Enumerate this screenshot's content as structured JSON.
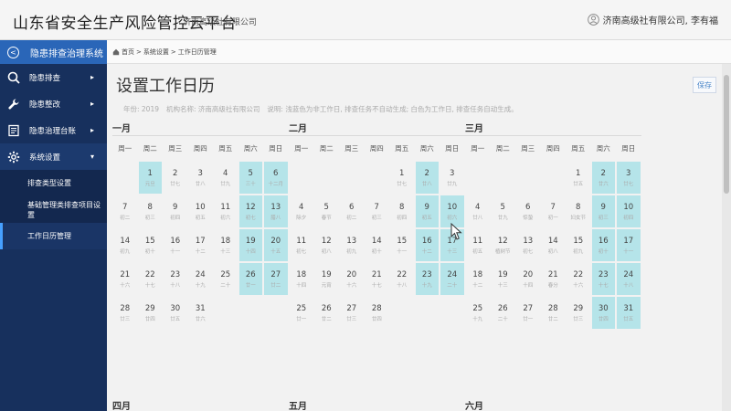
{
  "header": {
    "title": "山东省安全生产风险管控云平台",
    "org": "济南高级社有限公司",
    "user": "济南高级社有限公司, 李有福"
  },
  "sidebar": {
    "system_title": "隐患排查治理系统",
    "items": [
      {
        "label": "隐患排查",
        "icon": "search-icon",
        "arrow": "▸"
      },
      {
        "label": "隐患整改",
        "icon": "wrench-icon",
        "arrow": "▸"
      },
      {
        "label": "隐患治理台账",
        "icon": "ledger-icon",
        "arrow": "▸"
      },
      {
        "label": "系统设置",
        "icon": "gear-icon",
        "arrow": "▾"
      }
    ],
    "sub_items": [
      {
        "label": "排查类型设置"
      },
      {
        "label": "基础管理类排查项目设置"
      },
      {
        "label": "工作日历管理"
      }
    ]
  },
  "breadcrumb": {
    "home": "首页",
    "sep": ">",
    "level1": "系统设置",
    "level2": "工作日历管理"
  },
  "page": {
    "title": "设置工作日历",
    "save": "保存",
    "year": "年份: 2019",
    "org": "机构名称: 济南高级社有限公司",
    "note": "说明: 浅蓝色为非工作日, 排查任务不自动生成; 白色为工作日, 排查任务自动生成。"
  },
  "weekdays": [
    "周一",
    "周二",
    "周三",
    "周四",
    "周五",
    "周六",
    "周日"
  ],
  "months": [
    {
      "name": "一月",
      "offset": 1,
      "days": 31,
      "rest": [
        1,
        5,
        6,
        12,
        13,
        19,
        20,
        26,
        27
      ],
      "subs": {
        "1": "元旦",
        "2": "廿七",
        "3": "廿八",
        "4": "廿九",
        "5": "三十",
        "6": "十二月",
        "7": "初二",
        "8": "初三",
        "9": "初四",
        "10": "初五",
        "11": "初六",
        "12": "初七",
        "13": "腊八",
        "14": "初九",
        "15": "初十",
        "16": "十一",
        "17": "十二",
        "18": "十三",
        "19": "十四",
        "20": "十五",
        "21": "十六",
        "22": "十七",
        "23": "十八",
        "24": "十九",
        "25": "二十",
        "26": "廿一",
        "27": "廿二",
        "28": "廿三",
        "29": "廿四",
        "30": "廿五",
        "31": "廿六"
      }
    },
    {
      "name": "二月",
      "offset": 4,
      "days": 28,
      "rest": [
        2,
        9,
        10,
        16,
        17,
        23,
        24
      ],
      "subs": {
        "1": "廿七",
        "2": "廿八",
        "3": "廿九",
        "4": "除夕",
        "5": "春节",
        "6": "初二",
        "7": "初三",
        "8": "初四",
        "9": "初五",
        "10": "初六",
        "11": "初七",
        "12": "初八",
        "13": "初九",
        "14": "初十",
        "15": "十一",
        "16": "十二",
        "17": "十三",
        "18": "十四",
        "19": "元宵",
        "20": "十六",
        "21": "十七",
        "22": "十八",
        "23": "十九",
        "24": "二十",
        "25": "廿一",
        "26": "廿二",
        "27": "廿三",
        "28": "廿四"
      }
    },
    {
      "name": "三月",
      "offset": 4,
      "days": 31,
      "rest": [
        2,
        3,
        9,
        10,
        16,
        17,
        23,
        24,
        30,
        31
      ],
      "subs": {
        "1": "廿五",
        "2": "廿六",
        "3": "廿七",
        "4": "廿八",
        "5": "廿九",
        "6": "惊蛰",
        "7": "初一",
        "8": "妇女节",
        "9": "初三",
        "10": "初四",
        "11": "初五",
        "12": "植树节",
        "13": "初七",
        "14": "初八",
        "15": "初九",
        "16": "初十",
        "17": "十一",
        "18": "十二",
        "19": "十三",
        "20": "十四",
        "21": "春分",
        "22": "十六",
        "23": "十七",
        "24": "十八",
        "25": "十九",
        "26": "二十",
        "27": "廿一",
        "28": "廿二",
        "29": "廿三",
        "30": "廿四",
        "31": "廿五"
      }
    },
    {
      "name": "四月"
    },
    {
      "name": "五月"
    },
    {
      "name": "六月"
    }
  ],
  "colors": {
    "rest": "#b5e4e9",
    "sidebar": "#17305d",
    "system_title": "#2a66b8"
  }
}
